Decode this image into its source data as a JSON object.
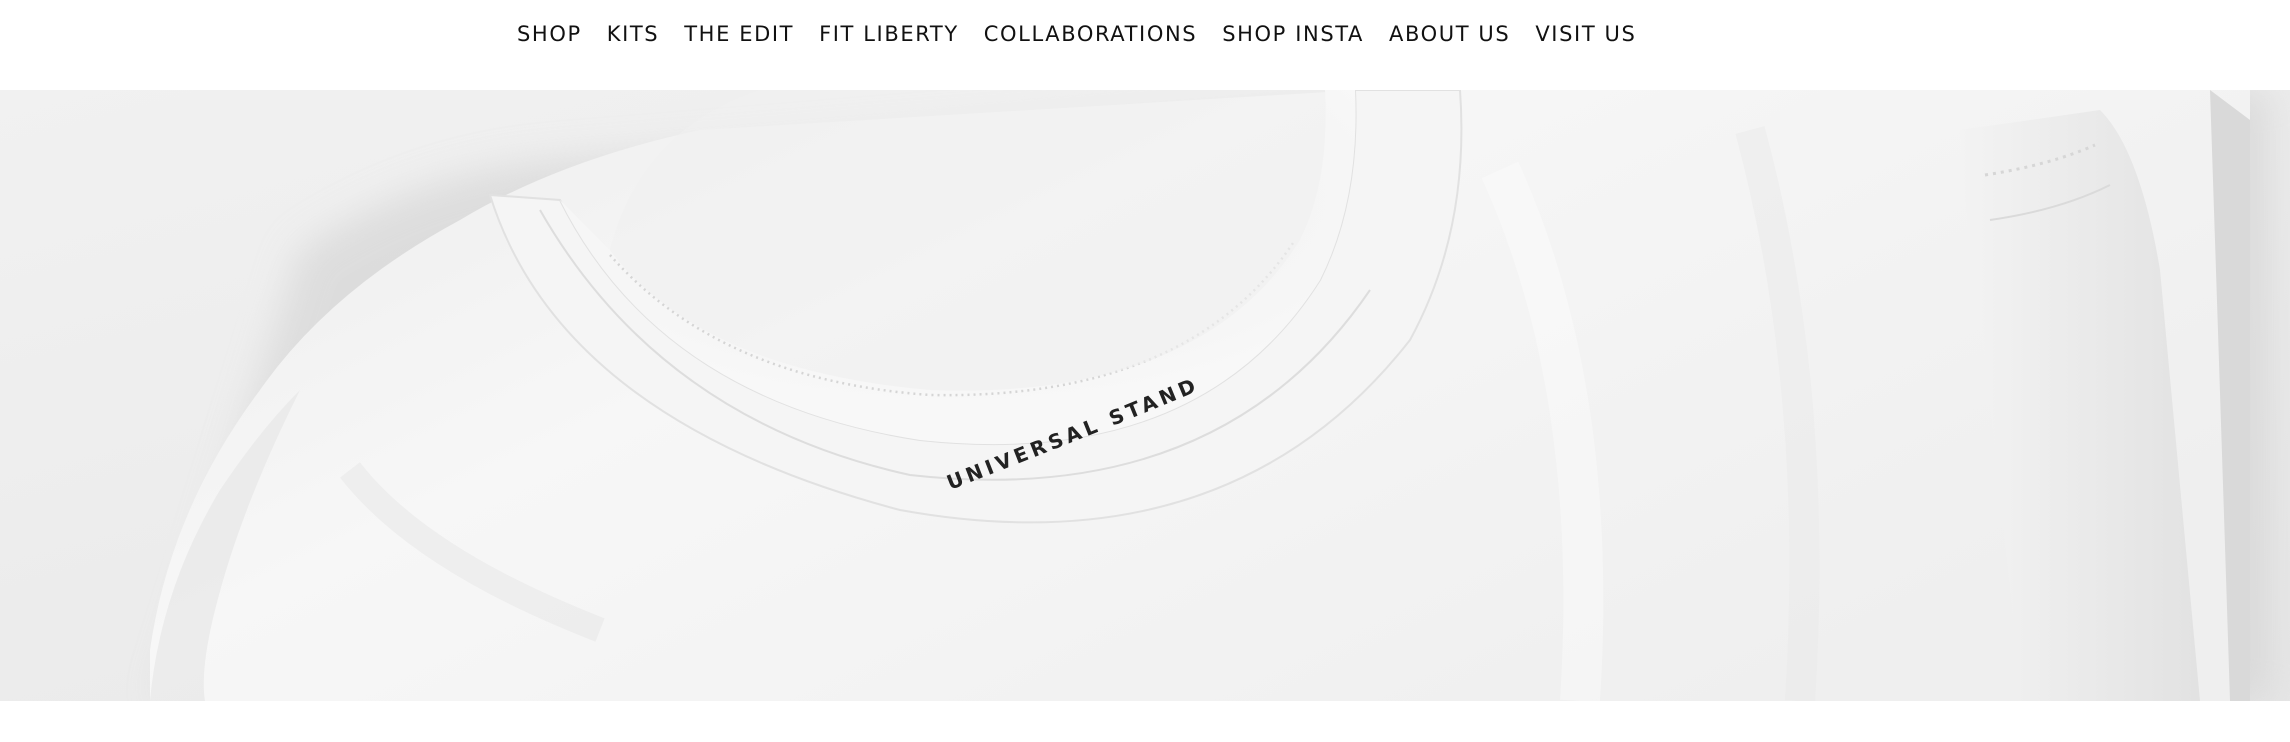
{
  "nav": {
    "items": [
      {
        "label": "SHOP"
      },
      {
        "label": "KITS"
      },
      {
        "label": "THE EDIT"
      },
      {
        "label": "FIT LIBERTY"
      },
      {
        "label": "COLLABORATIONS"
      },
      {
        "label": "SHOP INSTA"
      },
      {
        "label": "ABOUT US"
      },
      {
        "label": "VISIT US"
      }
    ]
  },
  "hero": {
    "tag_text": "UNIVERSAL STANDARD",
    "colors": {
      "background": "#ececec",
      "shirt": "#f6f6f6",
      "shadow": "#d2d2d2"
    }
  }
}
